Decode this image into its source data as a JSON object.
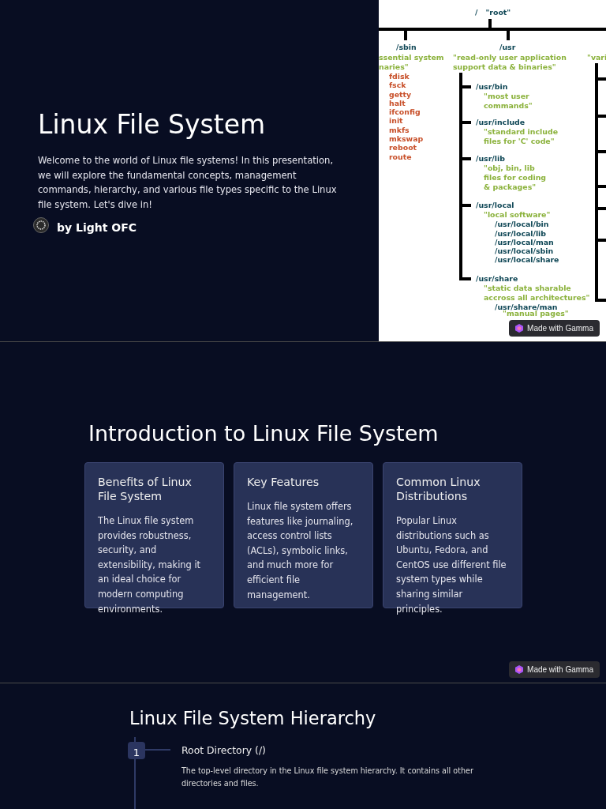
{
  "slides": [
    {
      "kind": "title",
      "title": "Linux File System",
      "body": "Welcome to the world of Linux file systems! In this presentation, we will explore the fundamental concepts, management commands, hierarchy, and various file types specific to the Linux file system. Let's dive in!",
      "author": "by Light OFC",
      "badge": "Made with Gamma",
      "diagram": {
        "root_path": "/",
        "root_label": "\"root\"",
        "sbin": {
          "path": "/sbin",
          "note": [
            "ssential system",
            "naries\""
          ],
          "files": [
            "fdisk",
            "fsck",
            "getty",
            "halt",
            "ifconfig",
            "init",
            "mkfs",
            "mkswap",
            "reboot",
            "route"
          ]
        },
        "usr": {
          "path": "/usr",
          "note": [
            "\"read-only user application",
            "support data & binaries\""
          ],
          "children": [
            {
              "path": "/usr/bin",
              "note": [
                "\"most user",
                "commands\""
              ]
            },
            {
              "path": "/usr/include",
              "note": [
                "\"standard include",
                "files for 'C' code\""
              ]
            },
            {
              "path": "/usr/lib",
              "note": [
                "\"obj, bin, lib",
                "files for coding",
                "& packages\""
              ]
            },
            {
              "path": "/usr/local",
              "note": [
                "\"local software\""
              ],
              "subdirs": [
                {
                  "path": "/usr/local/bin"
                },
                {
                  "path": "/usr/local/lib"
                },
                {
                  "path": "/usr/local/man"
                },
                {
                  "path": "/usr/local/sbin"
                },
                {
                  "path": "/usr/local/share"
                }
              ]
            },
            {
              "path": "/usr/share",
              "note": [
                "\"static data sharable",
                "accross all architectures\""
              ],
              "subdirs": [
                {
                  "path": "/usr/share/man",
                  "note": "\"manual pages\""
                }
              ]
            }
          ]
        },
        "third": {
          "note": "\"vari"
        }
      }
    },
    {
      "kind": "cards",
      "title": "Introduction to Linux File System",
      "badge": "Made with Gamma",
      "cards": [
        {
          "title": "Benefits of Linux File System",
          "body": "The Linux file system provides robustness, security, and extensibility, making it an ideal choice for modern computing environments."
        },
        {
          "title": "Key Features",
          "body": "Linux file system offers features like journaling, access control lists (ACLs), symbolic links, and much more for efficient file management."
        },
        {
          "title": "Common Linux Distributions",
          "body": "Popular Linux distributions such as Ubuntu, Fedora, and CentOS use different file system types while sharing similar principles."
        }
      ]
    },
    {
      "kind": "timeline",
      "title": "Linux File System Hierarchy",
      "steps": [
        {
          "number": "1",
          "title": "Root Directory (/)",
          "body": "The top-level directory in the Linux file system hierarchy. It contains all other directories and files."
        }
      ]
    }
  ]
}
